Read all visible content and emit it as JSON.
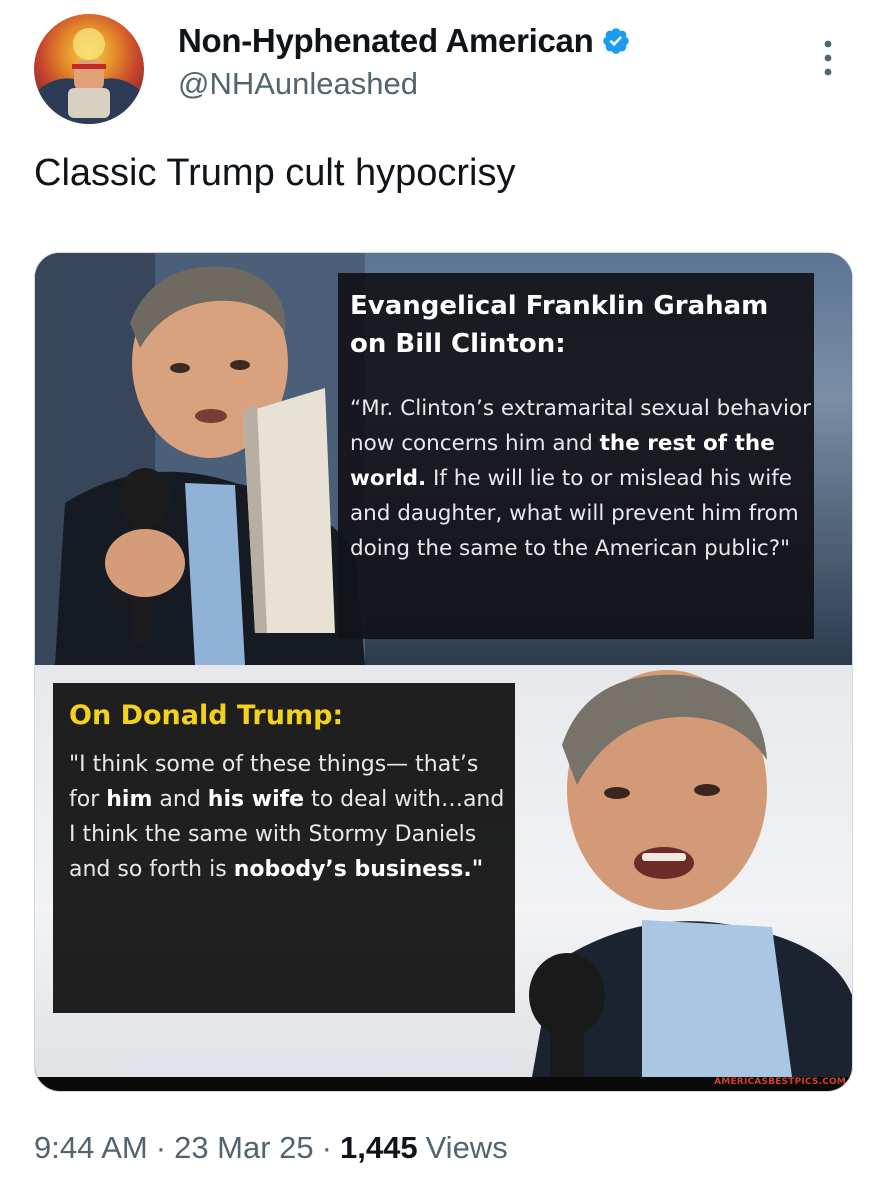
{
  "author": {
    "display_name": "Non-Hyphenated American",
    "handle": "@NHAunleashed",
    "verified_icon": "verified-badge-icon",
    "verified_color": "#1d9bf0"
  },
  "tweet": {
    "text": "Classic Trump cult hypocrisy"
  },
  "media": {
    "top_heading": "Evangelical Franklin Graham on Bill Clinton:",
    "top_quote": [
      {
        "t": "“Mr. Clinton’s extramarital sexual behavior now concerns him and ",
        "bold": false
      },
      {
        "t": "the rest of the world.",
        "bold": true
      },
      {
        "t": " If he will lie to or mislead his wife and daughter, what will prevent him from doing the same to the American public?\"",
        "bold": false
      }
    ],
    "bottom_heading": "On Donald Trump:",
    "bottom_quote": [
      {
        "t": "\"I think some of these things— that’s for ",
        "bold": false
      },
      {
        "t": "him",
        "bold": true
      },
      {
        "t": " and ",
        "bold": false
      },
      {
        "t": "his wife",
        "bold": true
      },
      {
        "t": " to deal with…and I think the same with Stormy Daniels and so forth is ",
        "bold": false
      },
      {
        "t": "nobody’s business.\"",
        "bold": true
      }
    ],
    "watermark": "AMERICASBESTPICS.COM",
    "heading_color_bottom": "#f2d21b"
  },
  "meta": {
    "time": "9:44 AM",
    "separator": "·",
    "date": "23 Mar 25",
    "views_count": "1,445",
    "views_label": "Views"
  }
}
